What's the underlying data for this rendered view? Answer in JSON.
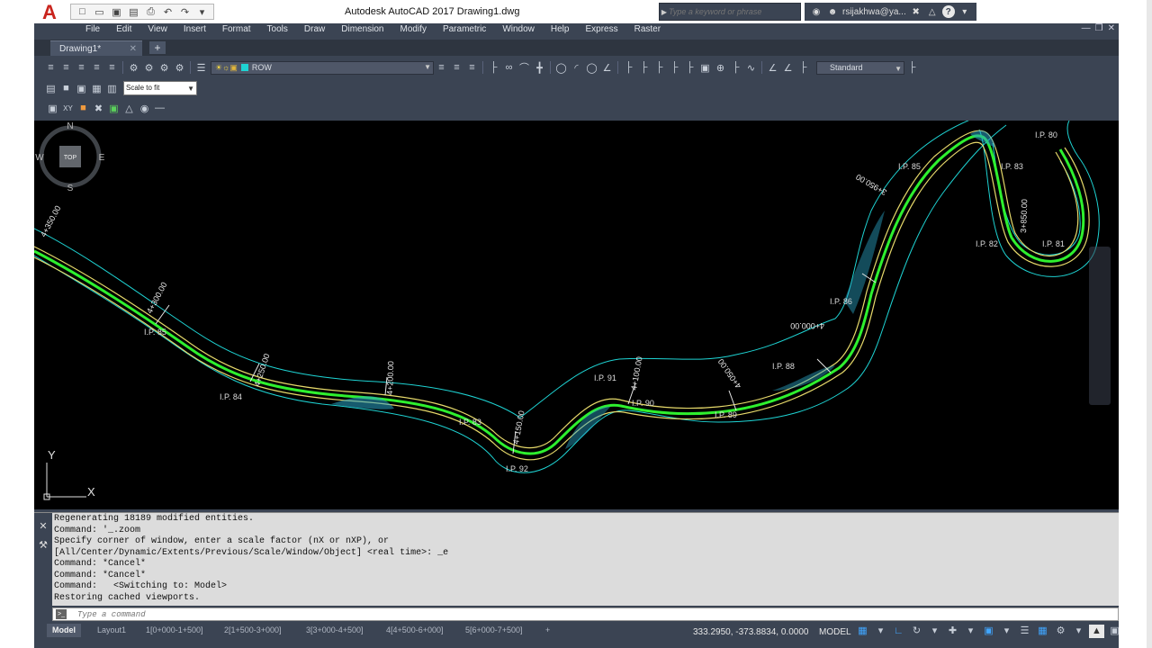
{
  "titlebar": {
    "app_logo": "A",
    "title": "Autodesk AutoCAD 2017    Drawing1.dwg",
    "search_placeholder": "Type a keyword or phrase",
    "user": "rsijakhwa@ya...",
    "help": "?"
  },
  "menu": [
    "File",
    "Edit",
    "View",
    "Insert",
    "Format",
    "Tools",
    "Draw",
    "Dimension",
    "Modify",
    "Parametric",
    "Window",
    "Help",
    "Express",
    "Raster"
  ],
  "tabs": {
    "drawing": "Drawing1*",
    "add": "+"
  },
  "toolbar": {
    "current_layer": "ROW",
    "text_style": "Standard",
    "scale": "Scale to fit"
  },
  "drawing": {
    "stations": [
      "4+350.00",
      "4+300.00",
      "4+250.00",
      "4+200.00",
      "4+150.00",
      "4+100.00",
      "4+050.00",
      "4+000.00",
      "3+950.00",
      "3+850.00"
    ],
    "ip_labels": [
      "I.P. 85",
      "I.P. 84",
      "I.P. 83",
      "I.P. 92",
      "I.P. 91",
      "I.P. 90",
      "I.P. 89",
      "I.P. 88",
      "I.P. 86",
      "I.P. 85",
      "I.P. 83",
      "I.P. 82",
      "I.P. 81",
      "I.P. 80"
    ],
    "ucs_y": "Y",
    "ucs_x": "X",
    "viewcube": {
      "top": "TOP",
      "east": "E",
      "south": "S",
      "west": "W",
      "north": "N"
    }
  },
  "command_history": [
    "Regenerating 18189 modified entities.",
    "Command: '_.zoom",
    "Specify corner of window, enter a scale factor (nX or nXP), or",
    "[All/Center/Dynamic/Extents/Previous/Scale/Window/Object] <real time>: _e",
    "Command: *Cancel*",
    "Command: *Cancel*",
    "Command:   <Switching to: Model>",
    "Restoring cached viewports."
  ],
  "command_input": {
    "placeholder": "Type a command"
  },
  "layout_tabs": [
    "Model",
    "Layout1",
    "1[0+000-1+500]",
    "2[1+500-3+000]",
    "3[3+000-4+500]",
    "4[4+500-6+000]",
    "5[6+000-7+500]",
    "+"
  ],
  "status": {
    "coordinates": "333.2950, -373.8834, 0.0000",
    "space": "MODEL"
  },
  "colors": {
    "alignment": "#2ef02e",
    "offset": "#e6d96a",
    "row": "#1ed3d3",
    "hatch": "#2aa6c8",
    "viewport": "#000000",
    "ui": "#3b4453"
  }
}
